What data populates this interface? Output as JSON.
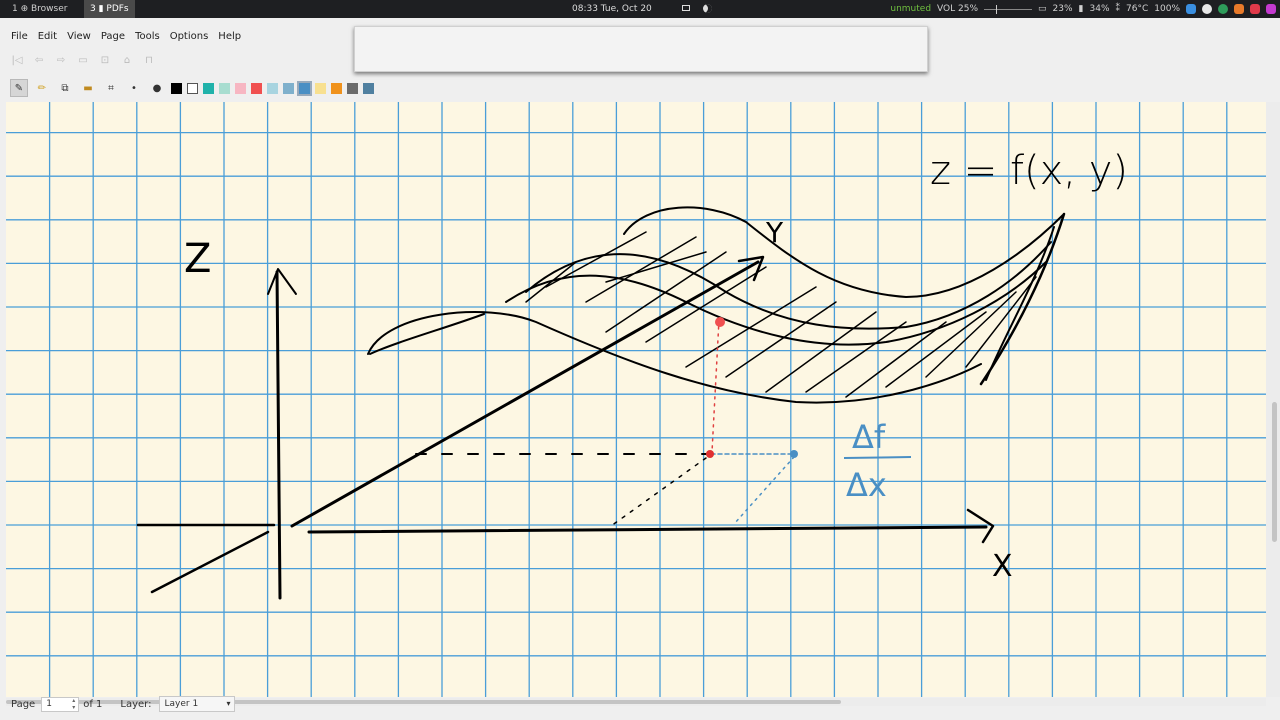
{
  "system_bar": {
    "workspaces": [
      {
        "label": "1 ⊕ Browser",
        "active": false
      },
      {
        "label": "3 ▮ PDFs",
        "active": true
      }
    ],
    "clock": "08:33 Tue, Oct 20",
    "unmuted": "unmuted",
    "volume": "VOL 25%",
    "volume_level": 0.25,
    "cpu": "23%",
    "battery": "34%",
    "temp": "76°C",
    "brightness": "100%"
  },
  "menu": [
    "File",
    "Edit",
    "View",
    "Page",
    "Tools",
    "Options",
    "Help"
  ],
  "palette": {
    "colors": [
      "#000000",
      "#ffffff",
      "#20b2aa",
      "#a8ddd0",
      "#f7b6c2",
      "#f05050",
      "#a8d4e0",
      "#7fb0cc",
      "#4a8fc4",
      "#f8e090",
      "#f0921c",
      "#6b6b6b",
      "#5080a0"
    ]
  },
  "canvas": {
    "bg": "#fdf7e3",
    "grid_color": "#4a9ed8",
    "labels": {
      "equation": "z = f(x, y)",
      "z_axis": "Z",
      "y_axis": "Y",
      "x_axis": "X",
      "delta_f": "Δf",
      "delta_x": "Δx"
    }
  },
  "status": {
    "page_label": "Page",
    "page_value": "1",
    "of_label": "of 1",
    "layer_label": "Layer:",
    "layer_value": "Layer 1"
  }
}
